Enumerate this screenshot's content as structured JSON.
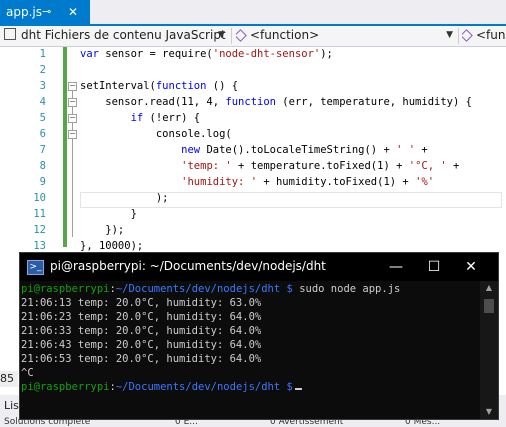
{
  "editor": {
    "tab": {
      "title": "app.js",
      "pin_glyph": "⊸",
      "close_glyph": "✕"
    },
    "nav": {
      "project": "dht Fichiers de contenu JavaScript",
      "scope": "<function>",
      "member": "<fun"
    },
    "line_numbers": [
      "1",
      "2",
      "3",
      "4",
      "5",
      "6",
      "7",
      "8",
      "9",
      "10",
      "11",
      "12",
      "13"
    ],
    "zoom": "85"
  },
  "vs_bottom": {
    "list_label": "Lis",
    "row2": [
      "Solutions complète",
      "0 E...",
      "0 Avertissement",
      "0 Mes..."
    ]
  },
  "terminal": {
    "title": "pi@raspberrypi: ~/Documents/dev/nodejs/dht",
    "prompt_user": "pi@raspberrypi",
    "prompt_sep": ":",
    "prompt_path": "~/Documents/dev/nodejs/dht",
    "prompt_dollar": "$",
    "command": "sudo node app.js",
    "output_lines": [
      "21:06:13 temp: 20.0°C, humidity: 63.0%",
      "21:06:23 temp: 20.0°C, humidity: 64.0%",
      "21:06:33 temp: 20.0°C, humidity: 64.0%",
      "21:06:43 temp: 20.0°C, humidity: 64.0%",
      "21:06:53 temp: 20.0°C, humidity: 64.0%"
    ],
    "interrupt": "^C",
    "minimize_glyph": "—",
    "maximize_glyph": "☐",
    "close_glyph": "✕"
  },
  "colors": {
    "vs_accent": "#007acc",
    "line_number": "#2b91af",
    "change_bar": "#57a64a",
    "keyword": "#0000ff",
    "string": "#a31515",
    "term_green": "#13a10e",
    "term_blue": "#3b78ff"
  }
}
